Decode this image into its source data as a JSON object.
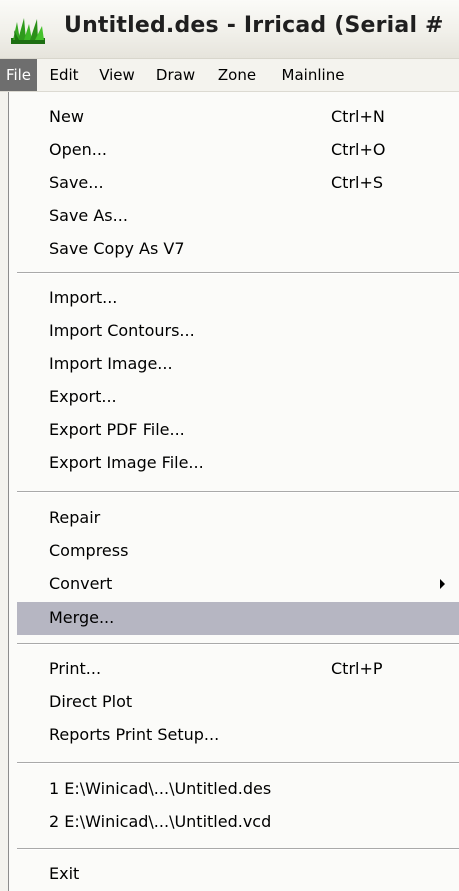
{
  "window": {
    "title": "Untitled.des - Irricad (Serial #",
    "icon": "irricad-grass-icon"
  },
  "menubar": {
    "items": [
      {
        "label": "File",
        "open": true
      },
      {
        "label": "Edit"
      },
      {
        "label": "View"
      },
      {
        "label": "Draw"
      },
      {
        "label": "Zone"
      },
      {
        "label": "Mainline"
      }
    ]
  },
  "file_menu": {
    "items": [
      {
        "label": "New",
        "shortcut": "Ctrl+N"
      },
      {
        "label": "Open...",
        "shortcut": "Ctrl+O"
      },
      {
        "label": "Save...",
        "shortcut": "Ctrl+S"
      },
      {
        "label": "Save As..."
      },
      {
        "label": "Save Copy As V7"
      },
      {
        "label": "Import..."
      },
      {
        "label": "Import Contours..."
      },
      {
        "label": "Import Image..."
      },
      {
        "label": "Export..."
      },
      {
        "label": "Export PDF File..."
      },
      {
        "label": "Export Image File..."
      },
      {
        "label": "Repair"
      },
      {
        "label": "Compress"
      },
      {
        "label": "Convert",
        "submenu": true
      },
      {
        "label": "Merge...",
        "highlighted": true
      },
      {
        "label": "Print...",
        "shortcut": "Ctrl+P"
      },
      {
        "label": "Direct Plot"
      },
      {
        "label": "Reports Print Setup..."
      },
      {
        "label": "1 E:\\Winicad\\...\\Untitled.des"
      },
      {
        "label": "2 E:\\Winicad\\...\\Untitled.vcd"
      },
      {
        "label": "Exit"
      }
    ]
  },
  "colors": {
    "menu_background": "#fbfbf9",
    "highlight": "#b6b6c2",
    "menubar_open": "#6e6e6e",
    "icon_green": "#2e9a1c"
  }
}
